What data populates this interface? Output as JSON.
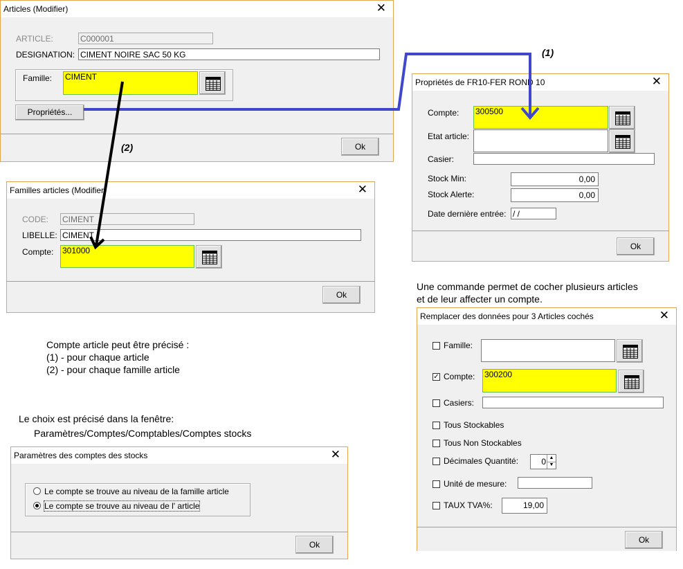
{
  "articles": {
    "title": "Articles  (Modifier)",
    "article_label": "ARTICLE:",
    "article_value": "C000001",
    "designation_label": "DESIGNATION:",
    "designation_value": "CIMENT NOIRE SAC 50 KG",
    "famille_label": "Famille:",
    "famille_value": "CIMENT",
    "proprietes_button": "Propriétés...",
    "ok": "Ok"
  },
  "annotations": {
    "one": "(1)",
    "two": "(2)"
  },
  "proprietes": {
    "title": "Propriétés de FR10-FER ROND 10",
    "compte_label": "Compte:",
    "compte_value": "300500",
    "etat_label": "Etat article:",
    "etat_value": "",
    "casier_label": "Casier:",
    "casier_value": "",
    "stock_min_label": "Stock Min:",
    "stock_min_value": "0,00",
    "stock_alerte_label": "Stock Alerte:",
    "stock_alerte_value": "0,00",
    "date_label": "Date dernière entrée:",
    "date_value": " /  /",
    "ok": "Ok"
  },
  "familles": {
    "title": "Familles articles  (Modifier)",
    "code_label": "CODE:",
    "code_value": "CIMENT",
    "libelle_label": "LIBELLE:",
    "libelle_value": "CIMENT",
    "compte_label": "Compte:",
    "compte_value": "301000",
    "ok": "Ok"
  },
  "note_commande": [
    "Une commande permet de cocher plusieurs articles",
    "et de leur affecter un compte."
  ],
  "remplacer": {
    "title": "Remplacer des données pour 3 Articles cochés",
    "famille_label": "Famille:",
    "famille_checked": false,
    "famille_value": "",
    "compte_label": "Compte:",
    "compte_checked": true,
    "compte_value": "300200",
    "casiers_label": "Casiers:",
    "casiers_checked": false,
    "casiers_value": "",
    "tous_stockables_label": "Tous Stockables",
    "tous_non_stockables_label": "Tous Non Stockables",
    "decimales_label": "Décimales Quantité:",
    "decimales_value": "0",
    "unite_label": "Unité de mesure:",
    "unite_value": "",
    "tva_label": "TAUX TVA%:",
    "tva_value": "19,00",
    "ok": "Ok"
  },
  "note_compte": [
    "Compte article peut être précisé :",
    "(1) - pour chaque article",
    "(2) - pour chaque famille article"
  ],
  "note_choix": [
    "Le choix est précisé dans la fenêtre:",
    "Paramètres/Comptes/Comptables/Comptes stocks"
  ],
  "parametres": {
    "title": "Paramètres des comptes des stocks",
    "option_famille": "Le compte se trouve au niveau de la famille article",
    "option_article": "Le compte se trouve au niveau de l' article",
    "selected": "article",
    "ok": "Ok"
  },
  "colors": {
    "highlight": "#ffff00",
    "arrow_blue": "#3f48cc",
    "window_border": "#e3a54e"
  }
}
